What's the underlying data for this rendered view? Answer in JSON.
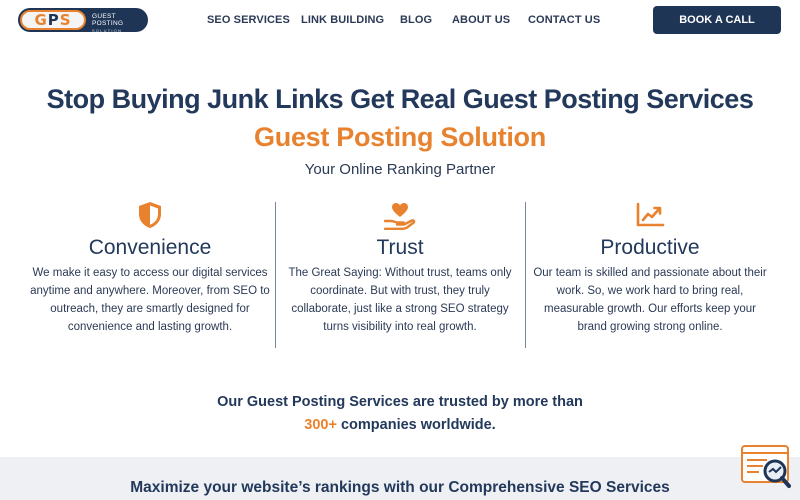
{
  "logo": {
    "mark_left": "G",
    "mark_mid": "P",
    "mark_right": "S",
    "name": "GUEST POSTING",
    "tagline": "SOLUTION"
  },
  "nav": {
    "items": [
      "SEO SERVICES",
      "LINK BUILDING",
      "BLOG",
      "ABOUT US",
      "CONTACT US"
    ],
    "cta": "BOOK A CALL"
  },
  "hero": {
    "title": "Stop Buying Junk Links Get Real Guest Posting Services",
    "subtitle": "Guest Posting Solution",
    "tagline": "Your Online Ranking Partner"
  },
  "features": [
    {
      "icon": "shield-icon",
      "title": "Convenience",
      "lines": [
        "We make it easy to access our digital services",
        "anytime and anywhere. Moreover, from SEO to",
        "outreach, they are smartly designed for",
        "convenience and lasting growth."
      ]
    },
    {
      "icon": "heart-hand-icon",
      "title": "Trust",
      "lines": [
        "The Great Saying: Without trust, teams only",
        "coordinate. But with trust, they truly",
        "collaborate, just like a strong SEO strategy",
        "turns visibility into real growth."
      ]
    },
    {
      "icon": "growth-chart-icon",
      "title": "Productive",
      "lines": [
        "Our team is skilled and passionate about their",
        "work. So, we work hard to bring real,",
        "measurable growth. Our efforts keep your",
        "brand growing strong online."
      ]
    }
  ],
  "trust": {
    "line1": "Our Guest Posting Services are trusted by more than",
    "count": "300+",
    "line2_rest": " companies worldwide."
  },
  "band": {
    "text": "Maximize your website’s rankings with our Comprehensive SEO Services"
  },
  "colors": {
    "navy": "#23395b",
    "orange": "#e8822e",
    "band": "#eef0f4"
  }
}
